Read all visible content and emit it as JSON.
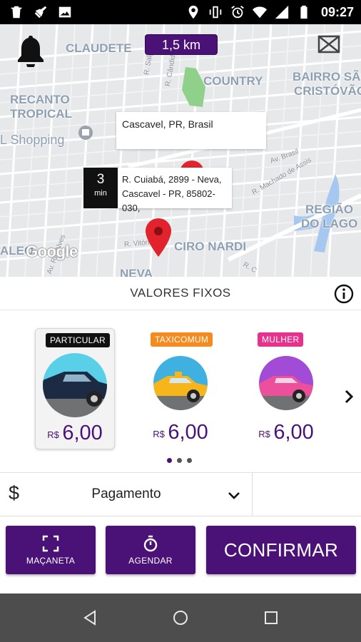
{
  "status_bar": {
    "time": "09:27",
    "left_icons": [
      "trash-icon",
      "broom-icon",
      "image-icon"
    ],
    "right_icons": [
      "location-icon",
      "vibrate-icon",
      "alarm-icon",
      "wifi-icon",
      "signal-icon",
      "battery-icon"
    ]
  },
  "map": {
    "distance": "1,5 km",
    "neighborhoods": {
      "claudete": "CLAUDETE",
      "country": "COUNTRY",
      "bairro_sao": "BAIRRO SÃO",
      "cristovao": "CRISTÓVÃO",
      "recanto": "RECANTO",
      "tropical": "TROPICAL",
      "shopping": "L Shopping",
      "regiao": "REGIÃO",
      "do_lago": "DO LAGO",
      "ciro_nardi": "CIRO NARDI",
      "aleo": "ALEO",
      "neva": "NEVA"
    },
    "streets": {
      "salgado": "R. Salgado F",
      "candido": "R. Cândido R",
      "brasil": "Av. Brasil",
      "machado": "R. Machado de Assis",
      "vitoria": "R. Vitória",
      "alves": "Av. Rio Alves",
      "rc": "R. C"
    },
    "city_card": "Cascavel, PR, Brasil",
    "eta_value": "3",
    "eta_unit": "min",
    "address_line1": "R. Cuiabá, 2899 - Neva,",
    "address_line2": "Cascavel - PR, 85802-030,",
    "google": "Google"
  },
  "fixed_values": {
    "title": "VALORES FIXOS"
  },
  "categories": [
    {
      "badge": "PARTICULAR",
      "currency": "R$",
      "price": "6,00",
      "badge_color": "#111111",
      "selected": true
    },
    {
      "badge": "TAXICOMUM",
      "currency": "R$",
      "price": "6,00",
      "badge_color": "#f58a1f",
      "selected": false
    },
    {
      "badge": "MULHER",
      "currency": "R$",
      "price": "6,00",
      "badge_color": "#e6328c",
      "selected": false
    }
  ],
  "carousel": {
    "pages": 3,
    "active": 0
  },
  "payment": {
    "currency_symbol": "$",
    "label": "Pagamento"
  },
  "actions": {
    "macaneta": "MAÇANETA",
    "agendar": "AGENDAR",
    "confirmar": "CONFIRMAR"
  },
  "colors": {
    "accent": "#4a1277",
    "map_bg": "#e6e8ea",
    "nav_bg": "#4d4d4d"
  }
}
